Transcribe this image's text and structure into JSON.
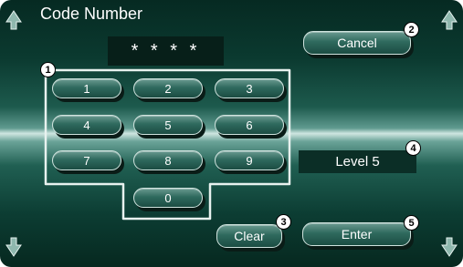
{
  "title": "Code Number",
  "code_display": "* * * *",
  "cancel_label": "Cancel",
  "keypad": [
    "1",
    "2",
    "3",
    "4",
    "5",
    "6",
    "7",
    "8",
    "9",
    "0"
  ],
  "level_display": "Level 5",
  "clear_label": "Clear",
  "enter_label": "Enter",
  "callouts": [
    "1",
    "2",
    "3",
    "4",
    "5"
  ],
  "colors": {
    "accent": "#2f6a5e",
    "background": "#0b3a30",
    "text": "#ffffff"
  },
  "icons": [
    "arrow-up-icon",
    "arrow-down-icon"
  ]
}
